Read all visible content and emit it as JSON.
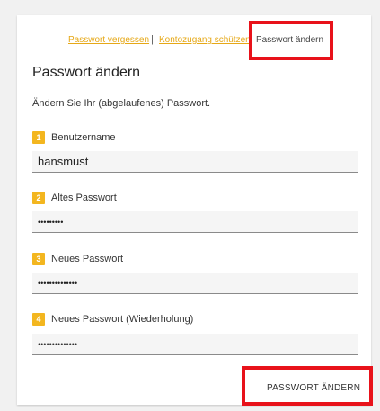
{
  "nav": {
    "forgot_password": "Passwort vergessen",
    "separator": "|",
    "protect_account": "Kontozugang schützen",
    "change_password": "Passwort ändern"
  },
  "title": "Passwort ändern",
  "description": "Ändern Sie Ihr (abgelaufenes) Passwort.",
  "fields": [
    {
      "number": "1",
      "label": "Benutzername",
      "value": "hansmust"
    },
    {
      "number": "2",
      "label": "Altes Passwort",
      "value": "•••••••••"
    },
    {
      "number": "3",
      "label": "Neues Passwort",
      "value": "••••••••••••••"
    },
    {
      "number": "4",
      "label": "Neues Passwort (Wiederholung)",
      "value": "••••••••••••••"
    }
  ],
  "submit_label": "PASSWORT ÄNDERN",
  "colors": {
    "accent": "#f3b61f",
    "link": "#e6a817",
    "highlight": "#e8121a"
  }
}
